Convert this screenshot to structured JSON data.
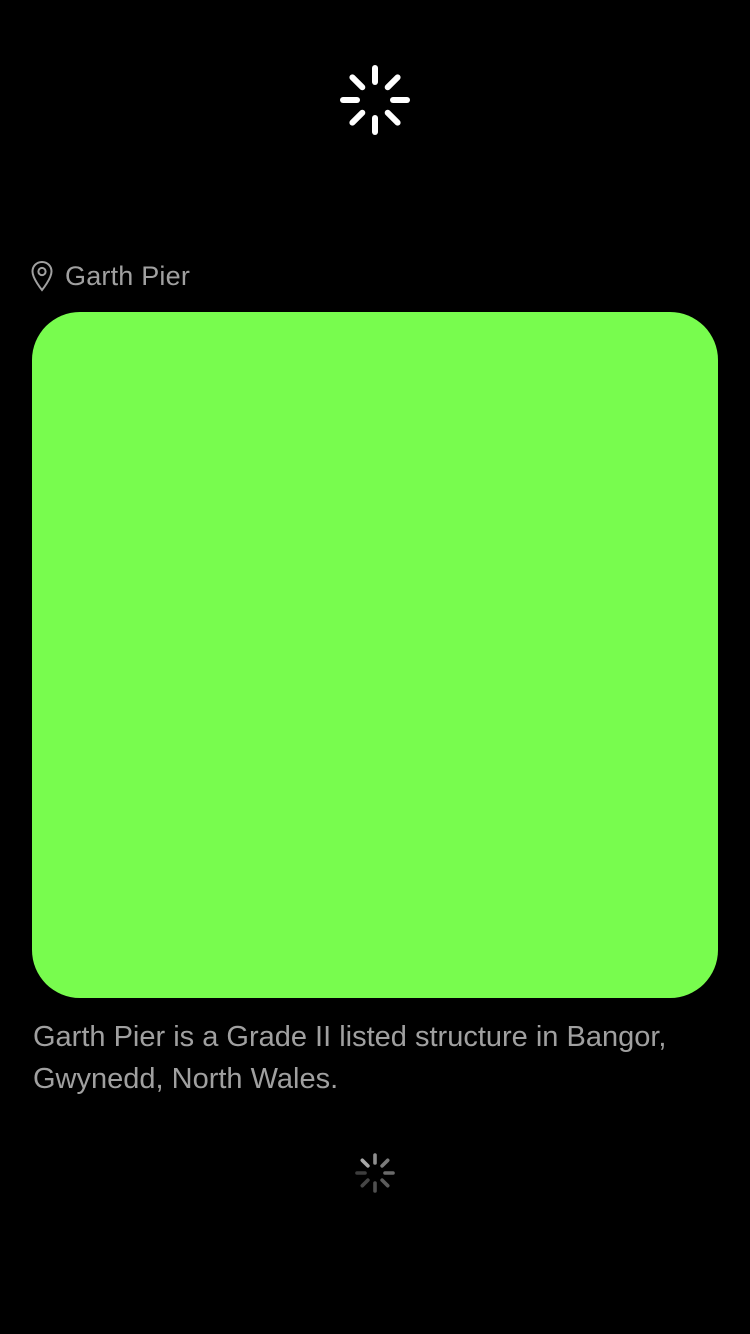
{
  "header": {
    "loading_indicator": "activity-spinner",
    "spinner_color": "#ffffff"
  },
  "location": {
    "icon": "map-pin-icon",
    "name": "Garth Pier"
  },
  "card": {
    "color": "#78fc4e"
  },
  "description": {
    "text": "Garth Pier is a Grade II listed structure in Bangor, Gwynedd, North Wales."
  },
  "footer": {
    "loading_indicator": "activity-spinner",
    "spinner_color": "#8e8e8e"
  },
  "colors": {
    "background": "#000000",
    "text": "#a0a0a0"
  }
}
